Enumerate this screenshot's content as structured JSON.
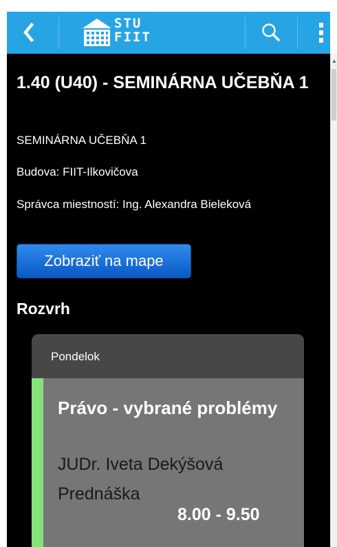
{
  "topbar": {
    "back_icon": "back-chevron-icon",
    "logo_icon": "building-icon",
    "logo_line1": "STU",
    "logo_line2": "FIIT",
    "search_icon": "search-icon",
    "menu_icon": "more-vertical-icon",
    "bar_color": "#27a4e4"
  },
  "room": {
    "title": "1.40 (U40) - SEMINÁRNA UČEBŇA 1",
    "subtitle": "SEMINÁRNA UČEBŇA 1",
    "building_label": "Budova:",
    "building_value": "FIIT-Ilkovičova",
    "manager_label": "Správca miestností:",
    "manager_value": "Ing. Alexandra Bieleková"
  },
  "map_button": {
    "label": "Zobraziť na mape",
    "color": "#1a6ed8"
  },
  "schedule": {
    "heading": "Rozvrh",
    "day": "Pondelok",
    "lessons": [
      {
        "name": "Právo - vybrané problémy",
        "teacher": "JUDr. Iveta Dekýšová",
        "type": "Prednáška",
        "time": "8.00 - 9.50",
        "stripe_color": "#86e07c"
      }
    ]
  }
}
